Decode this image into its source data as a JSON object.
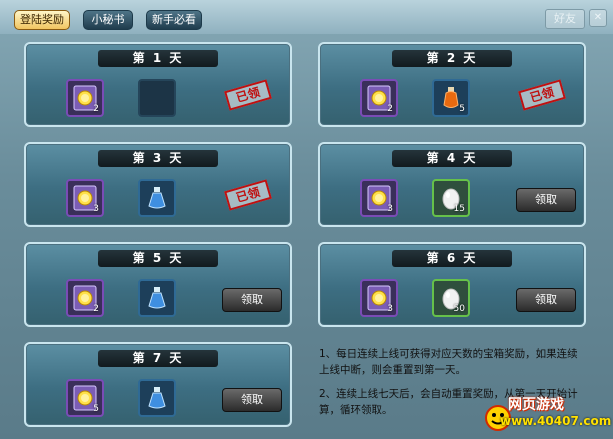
{
  "tabs": [
    {
      "label": "登陆奖励",
      "active": true
    },
    {
      "label": "小秘书",
      "active": false
    },
    {
      "label": "新手必看",
      "active": false
    }
  ],
  "friends_label": "好友",
  "days": [
    {
      "title": "第 1 天",
      "items": [
        {
          "icon": "coin-card-icon",
          "count": "2",
          "rarity": "purple"
        },
        {
          "icon": "empty-slot",
          "count": "",
          "rarity": "empty"
        }
      ],
      "state": "claimed",
      "stamp_text": "已领"
    },
    {
      "title": "第 2 天",
      "items": [
        {
          "icon": "coin-card-icon",
          "count": "2",
          "rarity": "purple"
        },
        {
          "icon": "orange-potion-icon",
          "count": "5",
          "rarity": "blue"
        }
      ],
      "state": "claimed",
      "stamp_text": "已领"
    },
    {
      "title": "第 3 天",
      "items": [
        {
          "icon": "coin-card-icon",
          "count": "3",
          "rarity": "purple"
        },
        {
          "icon": "blue-potion-icon",
          "count": "",
          "rarity": "blue"
        }
      ],
      "state": "claimed",
      "stamp_text": "已领"
    },
    {
      "title": "第 4 天",
      "items": [
        {
          "icon": "coin-card-icon",
          "count": "3",
          "rarity": "purple"
        },
        {
          "icon": "white-egg-icon",
          "count": "15",
          "rarity": "green"
        }
      ],
      "state": "available",
      "button_label": "领取"
    },
    {
      "title": "第 5 天",
      "items": [
        {
          "icon": "coin-card-icon",
          "count": "2",
          "rarity": "purple"
        },
        {
          "icon": "blue-potion-icon",
          "count": "",
          "rarity": "blue"
        }
      ],
      "state": "available",
      "button_label": "领取"
    },
    {
      "title": "第 6 天",
      "items": [
        {
          "icon": "coin-card-icon",
          "count": "3",
          "rarity": "purple"
        },
        {
          "icon": "white-egg-icon",
          "count": "50",
          "rarity": "green"
        }
      ],
      "state": "available",
      "button_label": "领取"
    },
    {
      "title": "第 7 天",
      "items": [
        {
          "icon": "coin-card-icon",
          "count": "5",
          "rarity": "purple"
        },
        {
          "icon": "blue-potion-icon",
          "count": "",
          "rarity": "blue"
        }
      ],
      "state": "available",
      "button_label": "领取"
    }
  ],
  "notes": [
    "1、每日连续上线可获得对应天数的宝箱奖励，如果连续上线中断，则会重置到第一天。",
    "2、连续上线七天后，会自动重置奖励，从第一天开始计算，循环领取。"
  ],
  "watermark": {
    "title": "网页游戏",
    "url": "www.40407.com"
  },
  "colors": {
    "claimed_stamp": "#c01010",
    "card_border": "#c9e5ee",
    "accent_tab": "#f1c561"
  }
}
